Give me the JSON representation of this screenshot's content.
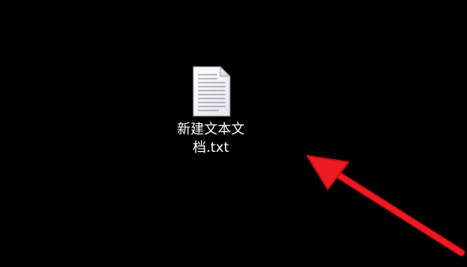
{
  "desktop": {
    "background_color": "#000000",
    "file": {
      "icon": "text-document-icon",
      "name": "新建文本文档.txt"
    }
  },
  "annotation": {
    "arrow_color": "#e8101a",
    "points_to": "file"
  }
}
